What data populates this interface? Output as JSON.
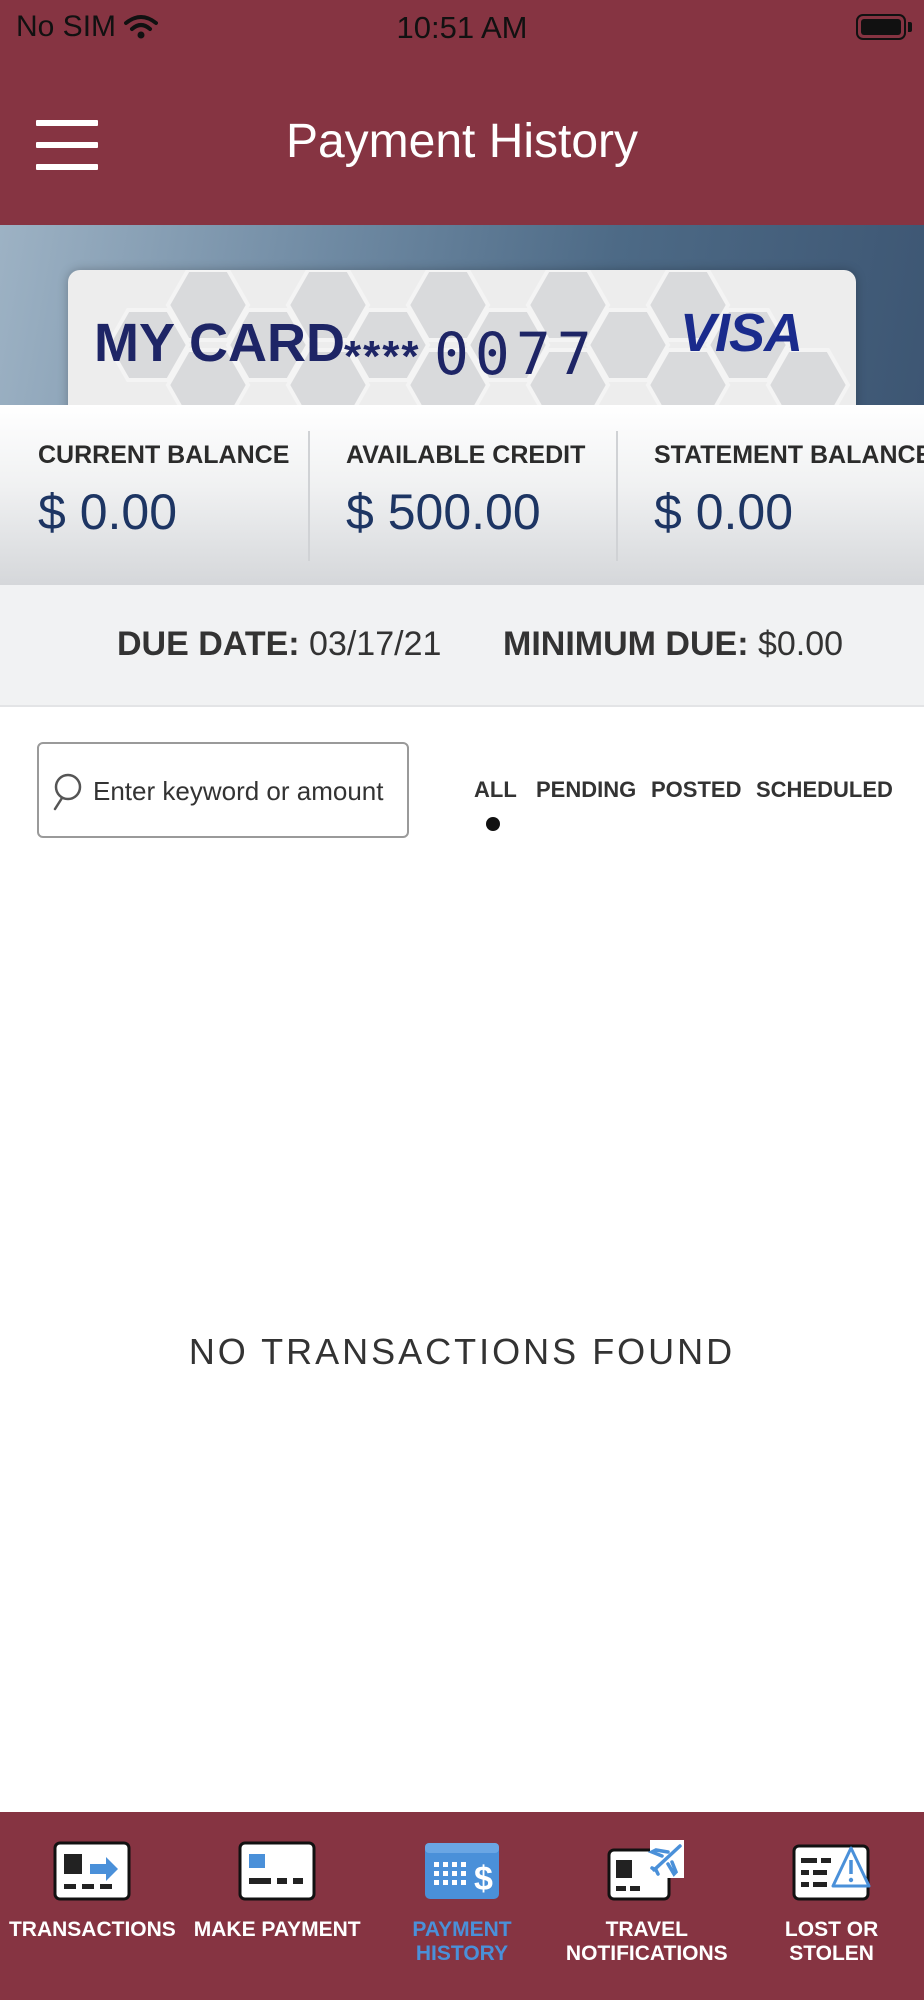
{
  "status_bar": {
    "carrier": "No SIM",
    "time": "10:51 AM"
  },
  "header": {
    "title": "Payment History",
    "menu_icon": "hamburger-menu-icon"
  },
  "card": {
    "name": "MY CARD",
    "mask": "****",
    "last4": "0077",
    "brand": "VISA"
  },
  "balances": [
    {
      "label": "CURRENT BALANCE",
      "value": "$ 0.00"
    },
    {
      "label": "AVAILABLE CREDIT",
      "value": "$ 500.00"
    },
    {
      "label": "STATEMENT BALANCE",
      "value": "$ 0.00"
    }
  ],
  "due": {
    "date_label": "DUE DATE:",
    "date_value": "03/17/21",
    "min_label": "MINIMUM DUE:",
    "min_value": "$0.00"
  },
  "search": {
    "placeholder": "Enter keyword or amount",
    "value": ""
  },
  "filters": {
    "tabs": [
      "ALL",
      "PENDING",
      "POSTED",
      "SCHEDULED"
    ],
    "selected": "ALL"
  },
  "empty_message": "NO TRANSACTIONS FOUND",
  "tab_bar": {
    "items": [
      {
        "label": "TRANSACTIONS",
        "icon": "transactions-card-icon",
        "active": false
      },
      {
        "label": "MAKE PAYMENT",
        "icon": "make-payment-card-icon",
        "active": false
      },
      {
        "label": "PAYMENT\nHISTORY",
        "icon": "payment-history-calendar-icon",
        "active": true
      },
      {
        "label": "TRAVEL\nNOTIFICATIONS",
        "icon": "travel-plane-icon",
        "active": false
      },
      {
        "label": "LOST OR\nSTOLEN",
        "icon": "lost-stolen-warning-icon",
        "active": false
      }
    ]
  },
  "colors": {
    "brand": "#863442",
    "accent_blue": "#4a90d9",
    "balance_text": "#1d3563",
    "card_text": "#1e2566"
  }
}
